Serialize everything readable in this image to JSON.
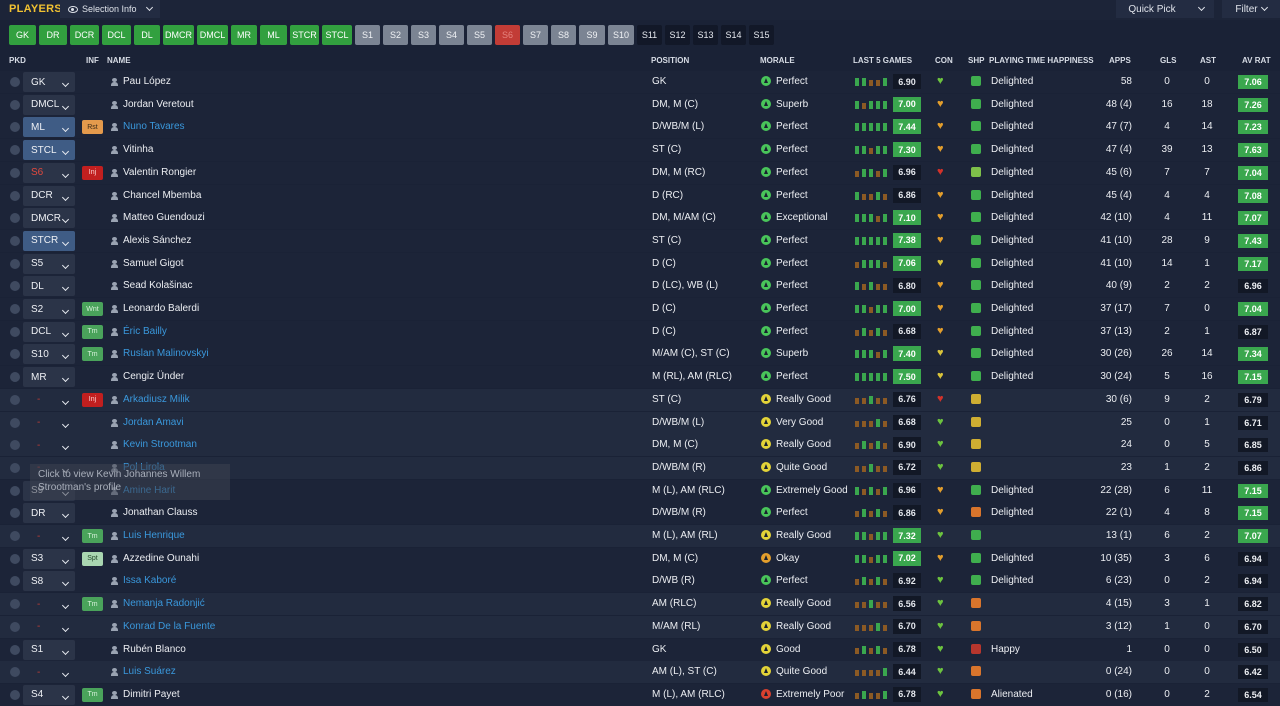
{
  "header": {
    "title": "PLAYERS",
    "selection_info": "Selection Info",
    "quick_pick": "Quick Pick",
    "filter": "Filter"
  },
  "chips": [
    {
      "label": "GK",
      "style": "g"
    },
    {
      "label": "DR",
      "style": "g"
    },
    {
      "label": "DCR",
      "style": "g"
    },
    {
      "label": "DCL",
      "style": "g"
    },
    {
      "label": "DL",
      "style": "g"
    },
    {
      "label": "DMCR",
      "style": "g"
    },
    {
      "label": "DMCL",
      "style": "g"
    },
    {
      "label": "MR",
      "style": "g"
    },
    {
      "label": "ML",
      "style": "g"
    },
    {
      "label": "STCR",
      "style": "g"
    },
    {
      "label": "STCL",
      "style": "g"
    },
    {
      "label": "S1",
      "style": "s"
    },
    {
      "label": "S2",
      "style": "s"
    },
    {
      "label": "S3",
      "style": "s"
    },
    {
      "label": "S4",
      "style": "s"
    },
    {
      "label": "S5",
      "style": "s"
    },
    {
      "label": "S6",
      "style": "r"
    },
    {
      "label": "S7",
      "style": "s"
    },
    {
      "label": "S8",
      "style": "s"
    },
    {
      "label": "S9",
      "style": "s"
    },
    {
      "label": "S10",
      "style": "s"
    },
    {
      "label": "S11",
      "style": "d"
    },
    {
      "label": "S12",
      "style": "d"
    },
    {
      "label": "S13",
      "style": "d"
    },
    {
      "label": "S14",
      "style": "d"
    },
    {
      "label": "S15",
      "style": "d"
    }
  ],
  "columns": {
    "pkd": "PKD",
    "inf": "INF",
    "name": "NAME",
    "position": "POSITION",
    "morale": "MORALE",
    "last5": "LAST 5 GAMES",
    "con": "CON",
    "shp": "SHP",
    "pth": "PLAYING TIME HAPPINESS",
    "apps": "APPS",
    "gls": "GLS",
    "ast": "AST",
    "avrat": "AV RAT"
  },
  "colors": {
    "green": "#3aa74e",
    "link": "#3a98dc",
    "accent": "#f1c232",
    "injury": "#c21f1f"
  },
  "rows": [
    {
      "pkd": "GK",
      "pkd_style": "n",
      "inf": "",
      "inf_style": "",
      "name": "Pau López",
      "link": false,
      "position": "GK",
      "morale": "Perfect",
      "morale_level": "gr",
      "last5": [
        3,
        3,
        2,
        2,
        3
      ],
      "rating": "6.90",
      "rating_style": "n",
      "con": "gr",
      "shp": "g",
      "pth": "Delighted",
      "apps": "58",
      "gls": "0",
      "ast": "0",
      "avrat": "7.06",
      "avrat_style": "g"
    },
    {
      "pkd": "DMCL",
      "pkd_style": "n",
      "inf": "",
      "inf_style": "",
      "name": "Jordan Veretout",
      "link": false,
      "position": "DM, M (C)",
      "morale": "Superb",
      "morale_level": "gr",
      "last5": [
        3,
        2,
        3,
        3,
        3
      ],
      "rating": "7.00",
      "rating_style": "g",
      "con": "or",
      "shp": "g",
      "pth": "Delighted",
      "apps": "48 (4)",
      "gls": "16",
      "ast": "18",
      "avrat": "7.26",
      "avrat_style": "g"
    },
    {
      "pkd": "ML",
      "pkd_style": "b",
      "inf": "Rst",
      "inf_style": "rst",
      "name": "Nuno Tavares",
      "link": true,
      "position": "D/WB/M (L)",
      "morale": "Perfect",
      "morale_level": "gr",
      "last5": [
        3,
        3,
        3,
        3,
        3
      ],
      "rating": "7.44",
      "rating_style": "g",
      "con": "or",
      "shp": "g",
      "pth": "Delighted",
      "apps": "47 (7)",
      "gls": "4",
      "ast": "14",
      "avrat": "7.23",
      "avrat_style": "g"
    },
    {
      "pkd": "STCL",
      "pkd_style": "b",
      "inf": "",
      "inf_style": "",
      "name": "Vitinha",
      "link": false,
      "position": "ST (C)",
      "morale": "Perfect",
      "morale_level": "gr",
      "last5": [
        3,
        3,
        2,
        3,
        3
      ],
      "rating": "7.30",
      "rating_style": "g",
      "con": "or",
      "shp": "g",
      "pth": "Delighted",
      "apps": "47 (4)",
      "gls": "39",
      "ast": "13",
      "avrat": "7.63",
      "avrat_style": "g"
    },
    {
      "pkd": "S6",
      "pkd_style": "r",
      "inf": "Inj",
      "inf_style": "inj",
      "name": "Valentin Rongier",
      "link": false,
      "position": "DM, M (RC)",
      "morale": "Perfect",
      "morale_level": "gr",
      "last5": [
        2,
        3,
        3,
        2,
        3
      ],
      "rating": "6.96",
      "rating_style": "n",
      "con": "rd",
      "shp": "gl",
      "pth": "Delighted",
      "apps": "45 (6)",
      "gls": "7",
      "ast": "7",
      "avrat": "7.04",
      "avrat_style": "g"
    },
    {
      "pkd": "DCR",
      "pkd_style": "n",
      "inf": "",
      "inf_style": "",
      "name": "Chancel Mbemba",
      "link": false,
      "position": "D (RC)",
      "morale": "Perfect",
      "morale_level": "gr",
      "last5": [
        3,
        2,
        2,
        3,
        2
      ],
      "rating": "6.86",
      "rating_style": "n",
      "con": "or",
      "shp": "g",
      "pth": "Delighted",
      "apps": "45 (4)",
      "gls": "4",
      "ast": "4",
      "avrat": "7.08",
      "avrat_style": "g"
    },
    {
      "pkd": "DMCR",
      "pkd_style": "n",
      "inf": "",
      "inf_style": "",
      "name": "Matteo Guendouzi",
      "link": false,
      "position": "DM, M/AM (C)",
      "morale": "Exceptional",
      "morale_level": "gr",
      "last5": [
        3,
        3,
        3,
        2,
        3
      ],
      "rating": "7.10",
      "rating_style": "g",
      "con": "or",
      "shp": "g",
      "pth": "Delighted",
      "apps": "42 (10)",
      "gls": "4",
      "ast": "11",
      "avrat": "7.07",
      "avrat_style": "g"
    },
    {
      "pkd": "STCR",
      "pkd_style": "b",
      "inf": "",
      "inf_style": "",
      "name": "Alexis Sánchez",
      "link": false,
      "position": "ST (C)",
      "morale": "Perfect",
      "morale_level": "gr",
      "last5": [
        3,
        3,
        3,
        3,
        3
      ],
      "rating": "7.38",
      "rating_style": "g",
      "con": "or",
      "shp": "g",
      "pth": "Delighted",
      "apps": "41 (10)",
      "gls": "28",
      "ast": "9",
      "avrat": "7.43",
      "avrat_style": "g"
    },
    {
      "pkd": "S5",
      "pkd_style": "n",
      "inf": "",
      "inf_style": "",
      "name": "Samuel Gigot",
      "link": false,
      "position": "D (C)",
      "morale": "Perfect",
      "morale_level": "gr",
      "last5": [
        2,
        3,
        3,
        3,
        2
      ],
      "rating": "7.06",
      "rating_style": "g",
      "con": "yl",
      "shp": "g",
      "pth": "Delighted",
      "apps": "41 (10)",
      "gls": "14",
      "ast": "1",
      "avrat": "7.17",
      "avrat_style": "g"
    },
    {
      "pkd": "DL",
      "pkd_style": "n",
      "inf": "",
      "inf_style": "",
      "name": "Sead Kolašinac",
      "link": false,
      "position": "D (LC), WB (L)",
      "morale": "Perfect",
      "morale_level": "gr",
      "last5": [
        3,
        2,
        3,
        2,
        2
      ],
      "rating": "6.80",
      "rating_style": "n",
      "con": "or",
      "shp": "g",
      "pth": "Delighted",
      "apps": "40 (9)",
      "gls": "2",
      "ast": "2",
      "avrat": "6.96",
      "avrat_style": "n"
    },
    {
      "pkd": "S2",
      "pkd_style": "n",
      "inf": "Wnt",
      "inf_style": "tm",
      "name": "Leonardo Balerdi",
      "link": false,
      "position": "D (C)",
      "morale": "Perfect",
      "morale_level": "gr",
      "last5": [
        3,
        3,
        2,
        3,
        3
      ],
      "rating": "7.00",
      "rating_style": "g",
      "con": "or",
      "shp": "g",
      "pth": "Delighted",
      "apps": "37 (17)",
      "gls": "7",
      "ast": "0",
      "avrat": "7.04",
      "avrat_style": "g"
    },
    {
      "pkd": "DCL",
      "pkd_style": "n",
      "inf": "Tm",
      "inf_style": "tm",
      "name": "Éric Bailly",
      "link": true,
      "position": "D (C)",
      "morale": "Perfect",
      "morale_level": "gr",
      "last5": [
        2,
        3,
        2,
        3,
        2
      ],
      "rating": "6.68",
      "rating_style": "n",
      "con": "or",
      "shp": "g",
      "pth": "Delighted",
      "apps": "37 (13)",
      "gls": "2",
      "ast": "1",
      "avrat": "6.87",
      "avrat_style": "n"
    },
    {
      "pkd": "S10",
      "pkd_style": "n",
      "inf": "Tm",
      "inf_style": "tm",
      "name": "Ruslan Malinovskyi",
      "link": true,
      "position": "M/AM (C), ST (C)",
      "morale": "Superb",
      "morale_level": "gr",
      "last5": [
        3,
        3,
        3,
        2,
        3
      ],
      "rating": "7.40",
      "rating_style": "g",
      "con": "yl",
      "shp": "g",
      "pth": "Delighted",
      "apps": "30 (26)",
      "gls": "26",
      "ast": "14",
      "avrat": "7.34",
      "avrat_style": "g"
    },
    {
      "pkd": "MR",
      "pkd_style": "n",
      "inf": "",
      "inf_style": "",
      "name": "Cengiz Ünder",
      "link": false,
      "position": "M (RL), AM (RLC)",
      "morale": "Perfect",
      "morale_level": "gr",
      "last5": [
        3,
        3,
        3,
        3,
        3
      ],
      "rating": "7.50",
      "rating_style": "g",
      "con": "yl",
      "shp": "g",
      "pth": "Delighted",
      "apps": "30 (24)",
      "gls": "5",
      "ast": "16",
      "avrat": "7.15",
      "avrat_style": "g"
    },
    {
      "pkd": "-",
      "pkd_style": "d",
      "inf": "Inj",
      "inf_style": "inj",
      "name": "Arkadiusz Milik",
      "link": true,
      "position": "ST (C)",
      "morale": "Really Good",
      "morale_level": "yl",
      "last5": [
        2,
        2,
        3,
        2,
        2
      ],
      "rating": "6.76",
      "rating_style": "n",
      "con": "rd",
      "shp": "y",
      "pth": "",
      "apps": "30 (6)",
      "gls": "9",
      "ast": "2",
      "avrat": "6.79",
      "avrat_style": "n"
    },
    {
      "pkd": "-",
      "pkd_style": "d",
      "inf": "",
      "inf_style": "",
      "name": "Jordan Amavi",
      "link": true,
      "position": "D/WB/M (L)",
      "morale": "Very Good",
      "morale_level": "yl",
      "last5": [
        2,
        2,
        2,
        3,
        2
      ],
      "rating": "6.68",
      "rating_style": "n",
      "con": "gr",
      "shp": "y",
      "pth": "",
      "apps": "25",
      "gls": "0",
      "ast": "1",
      "avrat": "6.71",
      "avrat_style": "n"
    },
    {
      "pkd": "-",
      "pkd_style": "d",
      "inf": "",
      "inf_style": "",
      "name": "Kevin Strootman",
      "link": true,
      "position": "DM, M (C)",
      "morale": "Really Good",
      "morale_level": "yl",
      "last5": [
        2,
        3,
        2,
        3,
        2
      ],
      "rating": "6.90",
      "rating_style": "n",
      "con": "gr",
      "shp": "y",
      "pth": "",
      "apps": "24",
      "gls": "0",
      "ast": "5",
      "avrat": "6.85",
      "avrat_style": "n"
    },
    {
      "pkd": "-",
      "pkd_style": "d",
      "inf": "",
      "inf_style": "",
      "name": "Pol Lirola",
      "link": true,
      "position": "D/WB/M (R)",
      "morale": "Quite Good",
      "morale_level": "yl",
      "last5": [
        2,
        2,
        3,
        2,
        2
      ],
      "rating": "6.72",
      "rating_style": "n",
      "con": "gr",
      "shp": "y",
      "pth": "",
      "apps": "23",
      "gls": "1",
      "ast": "2",
      "avrat": "6.86",
      "avrat_style": "n"
    },
    {
      "pkd": "S9",
      "pkd_style": "n",
      "inf": "",
      "inf_style": "",
      "name": "Amine Harit",
      "link": true,
      "position": "M (L), AM (RLC)",
      "morale": "Extremely Good",
      "morale_level": "gr",
      "last5": [
        3,
        2,
        3,
        2,
        3
      ],
      "rating": "6.96",
      "rating_style": "n",
      "con": "or",
      "shp": "g",
      "pth": "Delighted",
      "apps": "22 (28)",
      "gls": "6",
      "ast": "11",
      "avrat": "7.15",
      "avrat_style": "g"
    },
    {
      "pkd": "DR",
      "pkd_style": "n",
      "inf": "",
      "inf_style": "",
      "name": "Jonathan Clauss",
      "link": false,
      "position": "D/WB/M (R)",
      "morale": "Perfect",
      "morale_level": "gr",
      "last5": [
        2,
        3,
        2,
        3,
        2
      ],
      "rating": "6.86",
      "rating_style": "n",
      "con": "or",
      "shp": "o",
      "pth": "Delighted",
      "apps": "22 (1)",
      "gls": "4",
      "ast": "8",
      "avrat": "7.15",
      "avrat_style": "g"
    },
    {
      "pkd": "-",
      "pkd_style": "d",
      "inf": "Tm",
      "inf_style": "tm",
      "name": "Luis Henrique",
      "link": true,
      "position": "M (L), AM (RL)",
      "morale": "Really Good",
      "morale_level": "yl",
      "last5": [
        3,
        3,
        2,
        3,
        3
      ],
      "rating": "7.32",
      "rating_style": "g",
      "con": "gr",
      "shp": "g",
      "pth": "",
      "apps": "13 (1)",
      "gls": "6",
      "ast": "2",
      "avrat": "7.07",
      "avrat_style": "g"
    },
    {
      "pkd": "S3",
      "pkd_style": "n",
      "inf": "Spt",
      "inf_style": "spt",
      "name": "Azzedine Ounahi",
      "link": false,
      "position": "DM, M (C)",
      "morale": "Okay",
      "morale_level": "or",
      "last5": [
        3,
        3,
        2,
        3,
        3
      ],
      "rating": "7.02",
      "rating_style": "g",
      "con": "or",
      "shp": "g",
      "pth": "Delighted",
      "apps": "10 (35)",
      "gls": "3",
      "ast": "6",
      "avrat": "6.94",
      "avrat_style": "n"
    },
    {
      "pkd": "S8",
      "pkd_style": "n",
      "inf": "",
      "inf_style": "",
      "name": "Issa Kaboré",
      "link": true,
      "position": "D/WB (R)",
      "morale": "Perfect",
      "morale_level": "gr",
      "last5": [
        2,
        3,
        2,
        3,
        2
      ],
      "rating": "6.92",
      "rating_style": "n",
      "con": "gr",
      "shp": "g",
      "pth": "Delighted",
      "apps": "6 (23)",
      "gls": "0",
      "ast": "2",
      "avrat": "6.94",
      "avrat_style": "n"
    },
    {
      "pkd": "-",
      "pkd_style": "d",
      "inf": "Tm",
      "inf_style": "tm",
      "name": "Nemanja Radonjić",
      "link": true,
      "position": "AM (RLC)",
      "morale": "Really Good",
      "morale_level": "yl",
      "last5": [
        2,
        2,
        3,
        2,
        2
      ],
      "rating": "6.56",
      "rating_style": "n",
      "con": "gr",
      "shp": "o",
      "pth": "",
      "apps": "4 (15)",
      "gls": "3",
      "ast": "1",
      "avrat": "6.82",
      "avrat_style": "n"
    },
    {
      "pkd": "-",
      "pkd_style": "d",
      "inf": "",
      "inf_style": "",
      "name": "Konrad De la Fuente",
      "link": true,
      "position": "M/AM (RL)",
      "morale": "Really Good",
      "morale_level": "yl",
      "last5": [
        2,
        2,
        2,
        3,
        2
      ],
      "rating": "6.70",
      "rating_style": "n",
      "con": "gr",
      "shp": "o",
      "pth": "",
      "apps": "3 (12)",
      "gls": "1",
      "ast": "0",
      "avrat": "6.70",
      "avrat_style": "n"
    },
    {
      "pkd": "S1",
      "pkd_style": "n",
      "inf": "",
      "inf_style": "",
      "name": "Rubén Blanco",
      "link": false,
      "position": "GK",
      "morale": "Good",
      "morale_level": "yl",
      "last5": [
        2,
        3,
        2,
        3,
        2
      ],
      "rating": "6.78",
      "rating_style": "n",
      "con": "gr",
      "shp": "r",
      "pth": "Happy",
      "apps": "1",
      "gls": "0",
      "ast": "0",
      "avrat": "6.50",
      "avrat_style": "n"
    },
    {
      "pkd": "-",
      "pkd_style": "d",
      "inf": "",
      "inf_style": "",
      "name": "Luis Suárez",
      "link": true,
      "position": "AM (L), ST (C)",
      "morale": "Quite Good",
      "morale_level": "yl",
      "last5": [
        2,
        2,
        2,
        2,
        3
      ],
      "rating": "6.44",
      "rating_style": "n",
      "con": "gr",
      "shp": "o",
      "pth": "",
      "apps": "0 (24)",
      "gls": "0",
      "ast": "0",
      "avrat": "6.42",
      "avrat_style": "n"
    },
    {
      "pkd": "S4",
      "pkd_style": "n",
      "inf": "Tm",
      "inf_style": "tm",
      "name": "Dimitri Payet",
      "link": false,
      "position": "M (L), AM (RLC)",
      "morale": "Extremely Poor",
      "morale_level": "rd",
      "last5": [
        2,
        3,
        2,
        2,
        3
      ],
      "rating": "6.78",
      "rating_style": "n",
      "con": "gr",
      "shp": "o",
      "pth": "Alienated",
      "apps": "0 (16)",
      "gls": "0",
      "ast": "2",
      "avrat": "6.54",
      "avrat_style": "n"
    }
  ],
  "tooltip": "Click to view Kevin Johannes Willem Strootman's profile"
}
